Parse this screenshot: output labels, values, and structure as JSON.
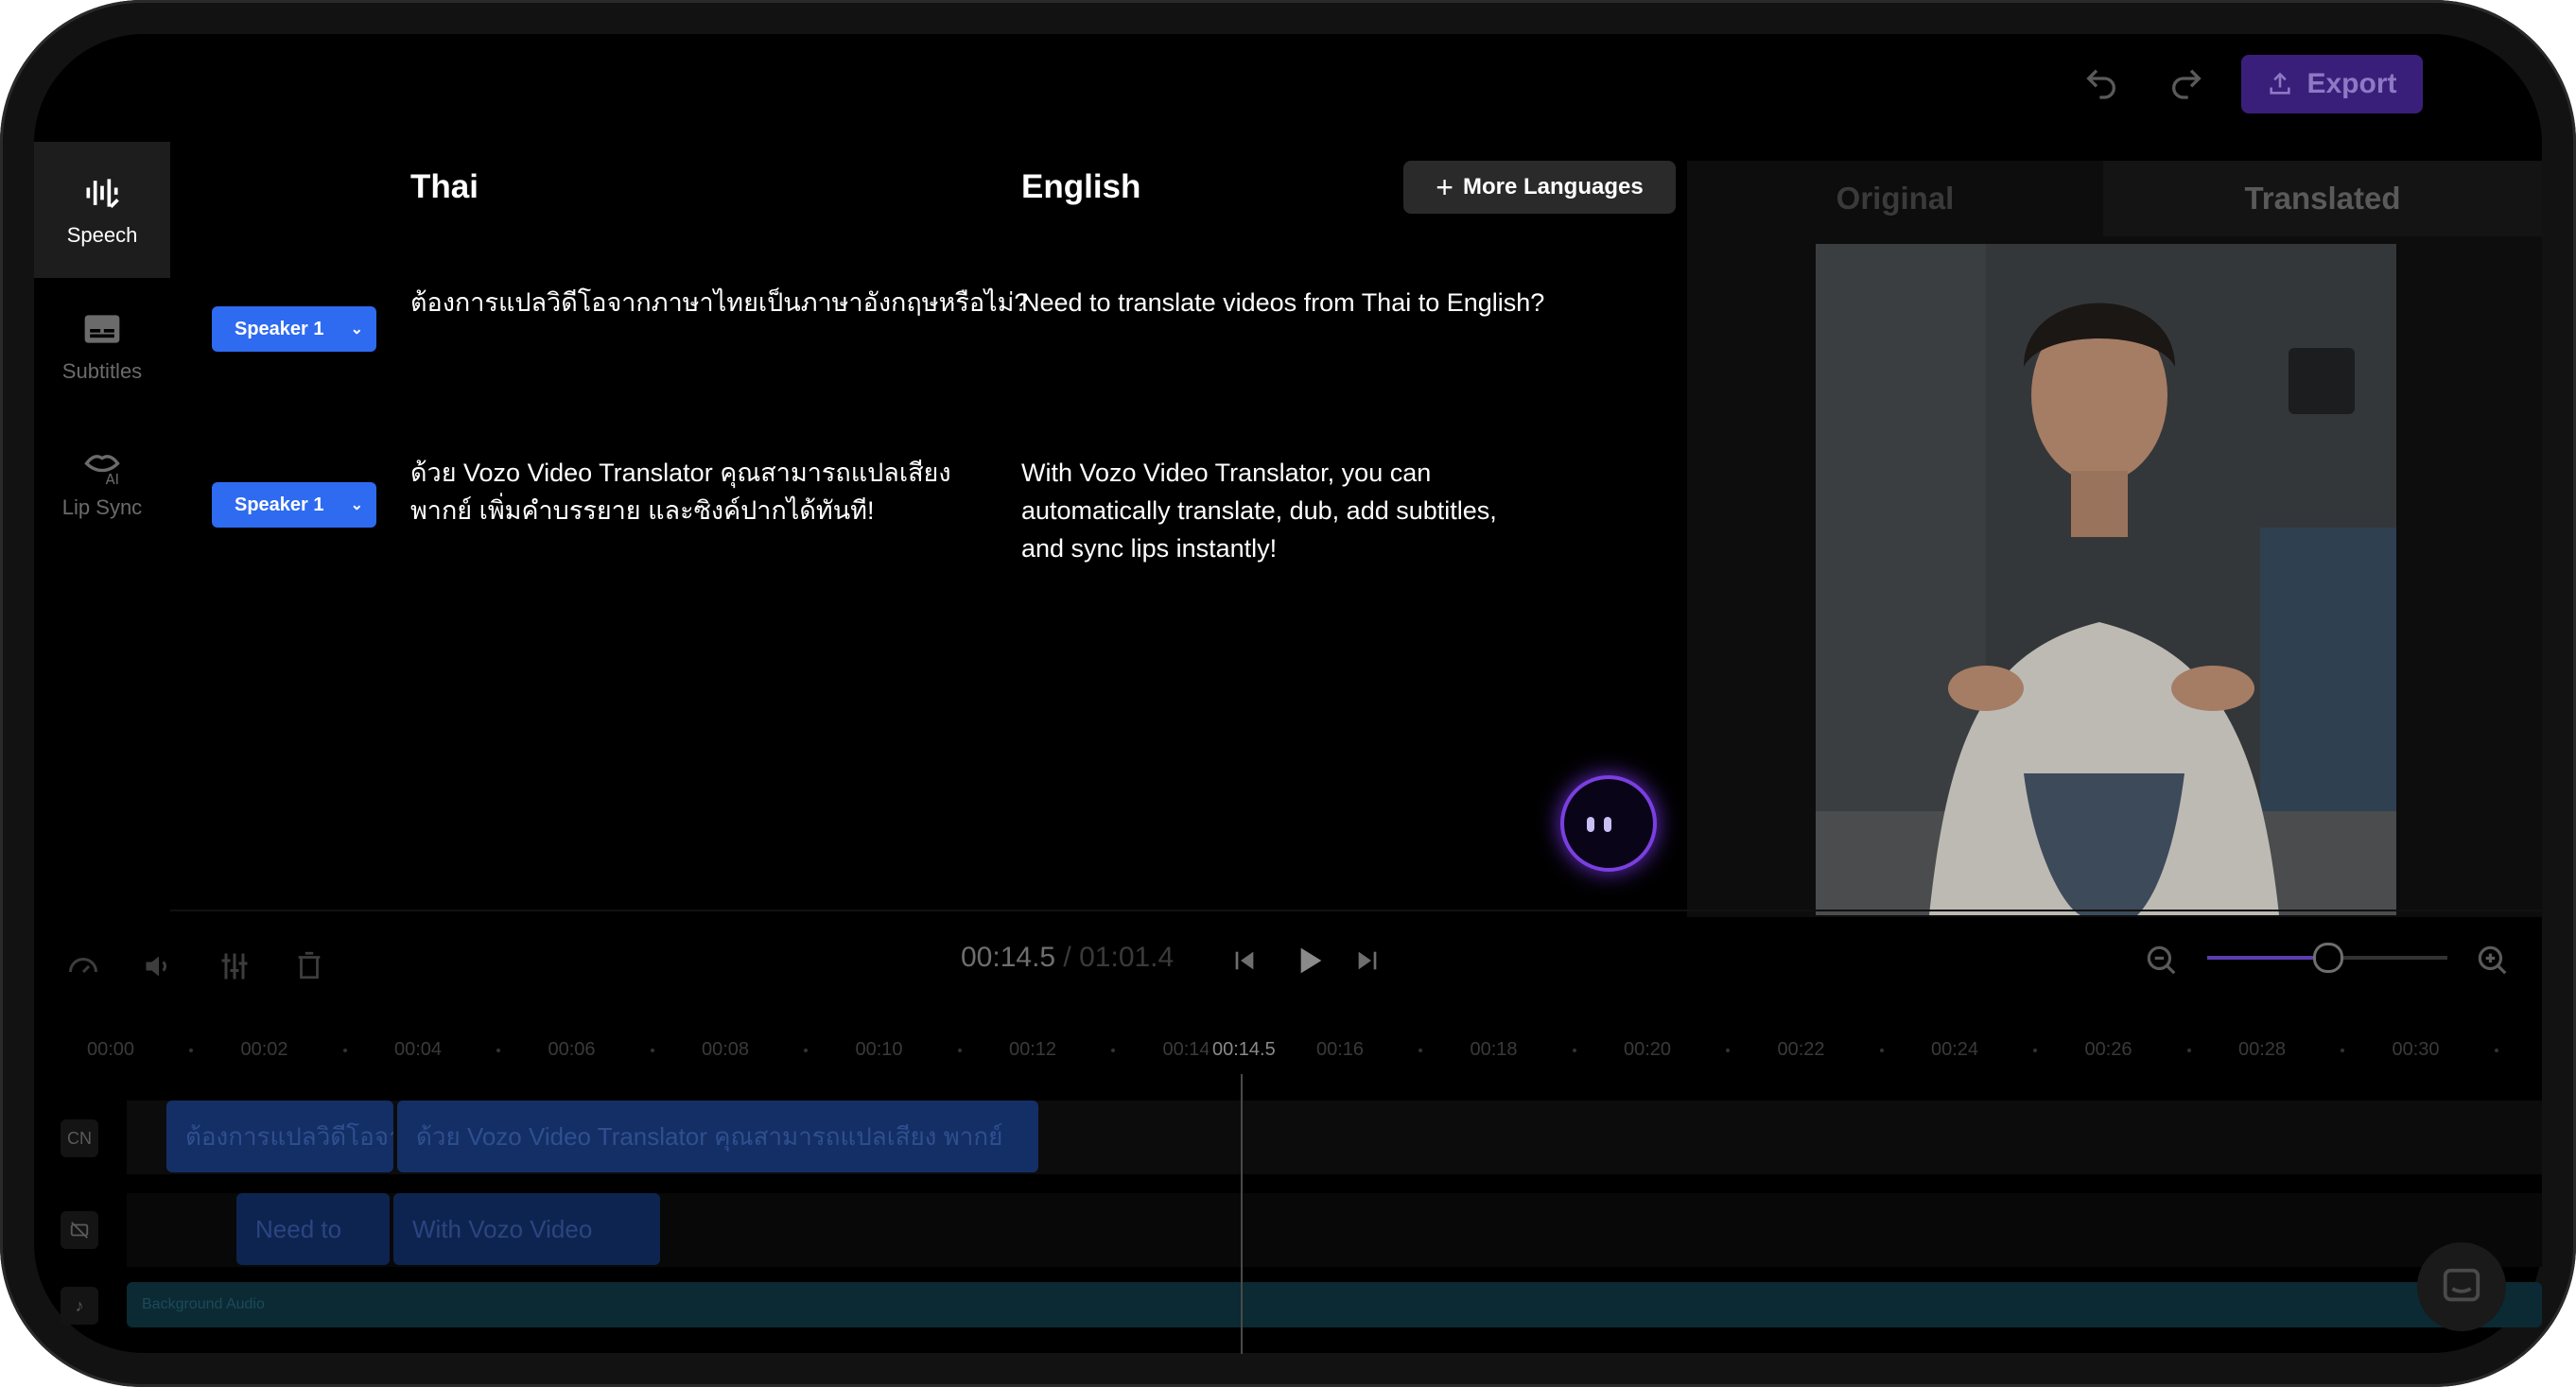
{
  "toolbar": {
    "undo_icon": "undo-icon",
    "redo_icon": "redo-icon",
    "export_label": "Export"
  },
  "sidebar": {
    "items": [
      {
        "label": "Speech",
        "icon": "speech-wave-icon",
        "active": true
      },
      {
        "label": "Subtitles",
        "icon": "subtitles-icon",
        "active": false
      },
      {
        "label": "Lip Sync",
        "icon": "lip-sync-icon",
        "active": false
      }
    ]
  },
  "speech": {
    "source_language": "Thai",
    "target_language": "English",
    "more_languages_label": "More Languages",
    "segments": [
      {
        "speaker": "Speaker 1",
        "source": "ต้องการแปลวิดีโอจากภาษาไทยเป็นภาษาอังกฤษหรือไม่?",
        "translation": "Need to translate videos from Thai to English?"
      },
      {
        "speaker": "Speaker 1",
        "source_line1": "ด้วย Vozo Video Translator คุณสามารถแปลเสียง",
        "source_line2": "พากย์ เพิ่มคำบรรยาย และซิงค์ปากได้ทันที!",
        "translation_line1": "With Vozo Video Translator, you can",
        "translation_line2": "automatically translate, dub, add subtitles,",
        "translation_line3": "and sync lips instantly!"
      }
    ]
  },
  "preview": {
    "tabs": [
      "Original",
      "Translated"
    ],
    "active_tab": "Translated"
  },
  "playback": {
    "current_time": "00:14.5",
    "separator": " / ",
    "total_time": "01:01.4",
    "zoom_fraction": 0.5
  },
  "timeline": {
    "ruler": [
      "00:00",
      "00:02",
      "00:04",
      "00:06",
      "00:08",
      "00:10",
      "00:12",
      "00:14",
      "00:16",
      "00:18",
      "00:20",
      "00:22",
      "00:24",
      "00:26",
      "00:28",
      "00:30"
    ],
    "playhead_label": "00:14.5",
    "tracks": {
      "subtitle_track_label": "CN",
      "subtitle_clips": [
        "ต้องการแปลวิดีโอจากภาษาไทยเป็นภาษาอังกฤษหรือไม่?",
        "ด้วย Vozo Video Translator คุณสามารถแปลเสียง พากย์"
      ],
      "voice_clips": [
        "Need to",
        "With Vozo Video"
      ],
      "background_audio_label": "Background Audio"
    }
  },
  "colors": {
    "accent": "#2f6bf0",
    "export": "#3a1f7a",
    "zoom_slider": "#5b3fb0"
  }
}
